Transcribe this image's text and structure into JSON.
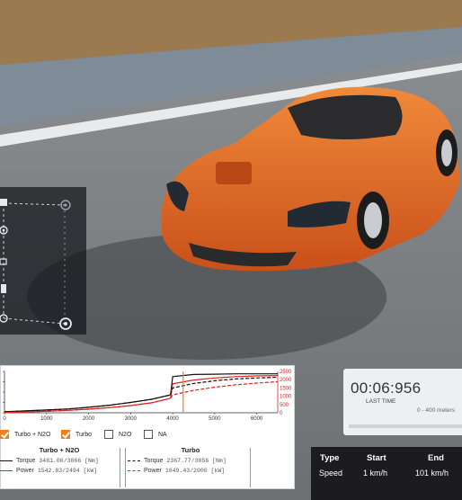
{
  "drivetrain": {
    "icons": [
      "engine-icon",
      "gearbox-icon",
      "differential-icon",
      "wheel-icon",
      "wheel-icon"
    ]
  },
  "graph": {
    "x_ticks": [
      "0",
      "1000",
      "2000",
      "3000",
      "4000",
      "5000",
      "6000"
    ],
    "right_ticks": [
      "2500",
      "2000",
      "1500",
      "1000",
      "500",
      "0"
    ],
    "chart_data": {
      "type": "line",
      "x": [
        0,
        500,
        1000,
        1500,
        2000,
        2500,
        3000,
        3500,
        3950,
        4000,
        4500,
        5000,
        5500,
        6000,
        6500
      ],
      "series": [
        {
          "name": "Torque",
          "style": "solid-black",
          "values": [
            30,
            55,
            80,
            110,
            160,
            220,
            300,
            390,
            520,
            1050,
            1110,
            1120,
            1130,
            1130,
            1130
          ]
        },
        {
          "name": "Power",
          "style": "solid-red",
          "values": [
            10,
            25,
            45,
            70,
            105,
            150,
            210,
            290,
            420,
            840,
            950,
            1010,
            1050,
            1070,
            1080
          ]
        },
        {
          "name": "Torque",
          "style": "dashed-black",
          "values": [
            30,
            55,
            80,
            110,
            160,
            220,
            300,
            390,
            520,
            720,
            850,
            930,
            980,
            1010,
            1030
          ]
        },
        {
          "name": "Power",
          "style": "dashed-red",
          "values": [
            10,
            25,
            45,
            70,
            105,
            150,
            210,
            290,
            420,
            520,
            650,
            740,
            810,
            860,
            900
          ]
        }
      ],
      "marker_rpm": 4250,
      "right_axis_range": [
        0,
        2500
      ]
    }
  },
  "config_options": [
    {
      "label": "Turbo + N2O",
      "checked": true
    },
    {
      "label": "Turbo",
      "checked": true
    },
    {
      "label": "N2O",
      "checked": false
    },
    {
      "label": "NA",
      "checked": false
    }
  ],
  "stats": {
    "left": {
      "title": "Turbo + N2O",
      "torque_label": "Torque",
      "torque_value": "3481.00/3866 [Nm]",
      "power_label": "Power",
      "power_value": "1542.83/2494 [kW]"
    },
    "right": {
      "title": "Turbo",
      "torque_label": "Torque",
      "torque_value": "2367.77/3056 [Nm]",
      "power_label": "Power",
      "power_value": "1049.43/2000 [kW]"
    }
  },
  "timer": {
    "value": "00:06:956",
    "caption": "LAST TIME",
    "range": "0 - 400 meters"
  },
  "speed_table": {
    "headers": [
      "Type",
      "Start",
      "End"
    ],
    "row": [
      "Speed",
      "1 km/h",
      "101 km/h"
    ]
  },
  "colors": {
    "car_body": "#e8671a",
    "accent_orange": "#f0801e",
    "power_red": "#e02020"
  }
}
